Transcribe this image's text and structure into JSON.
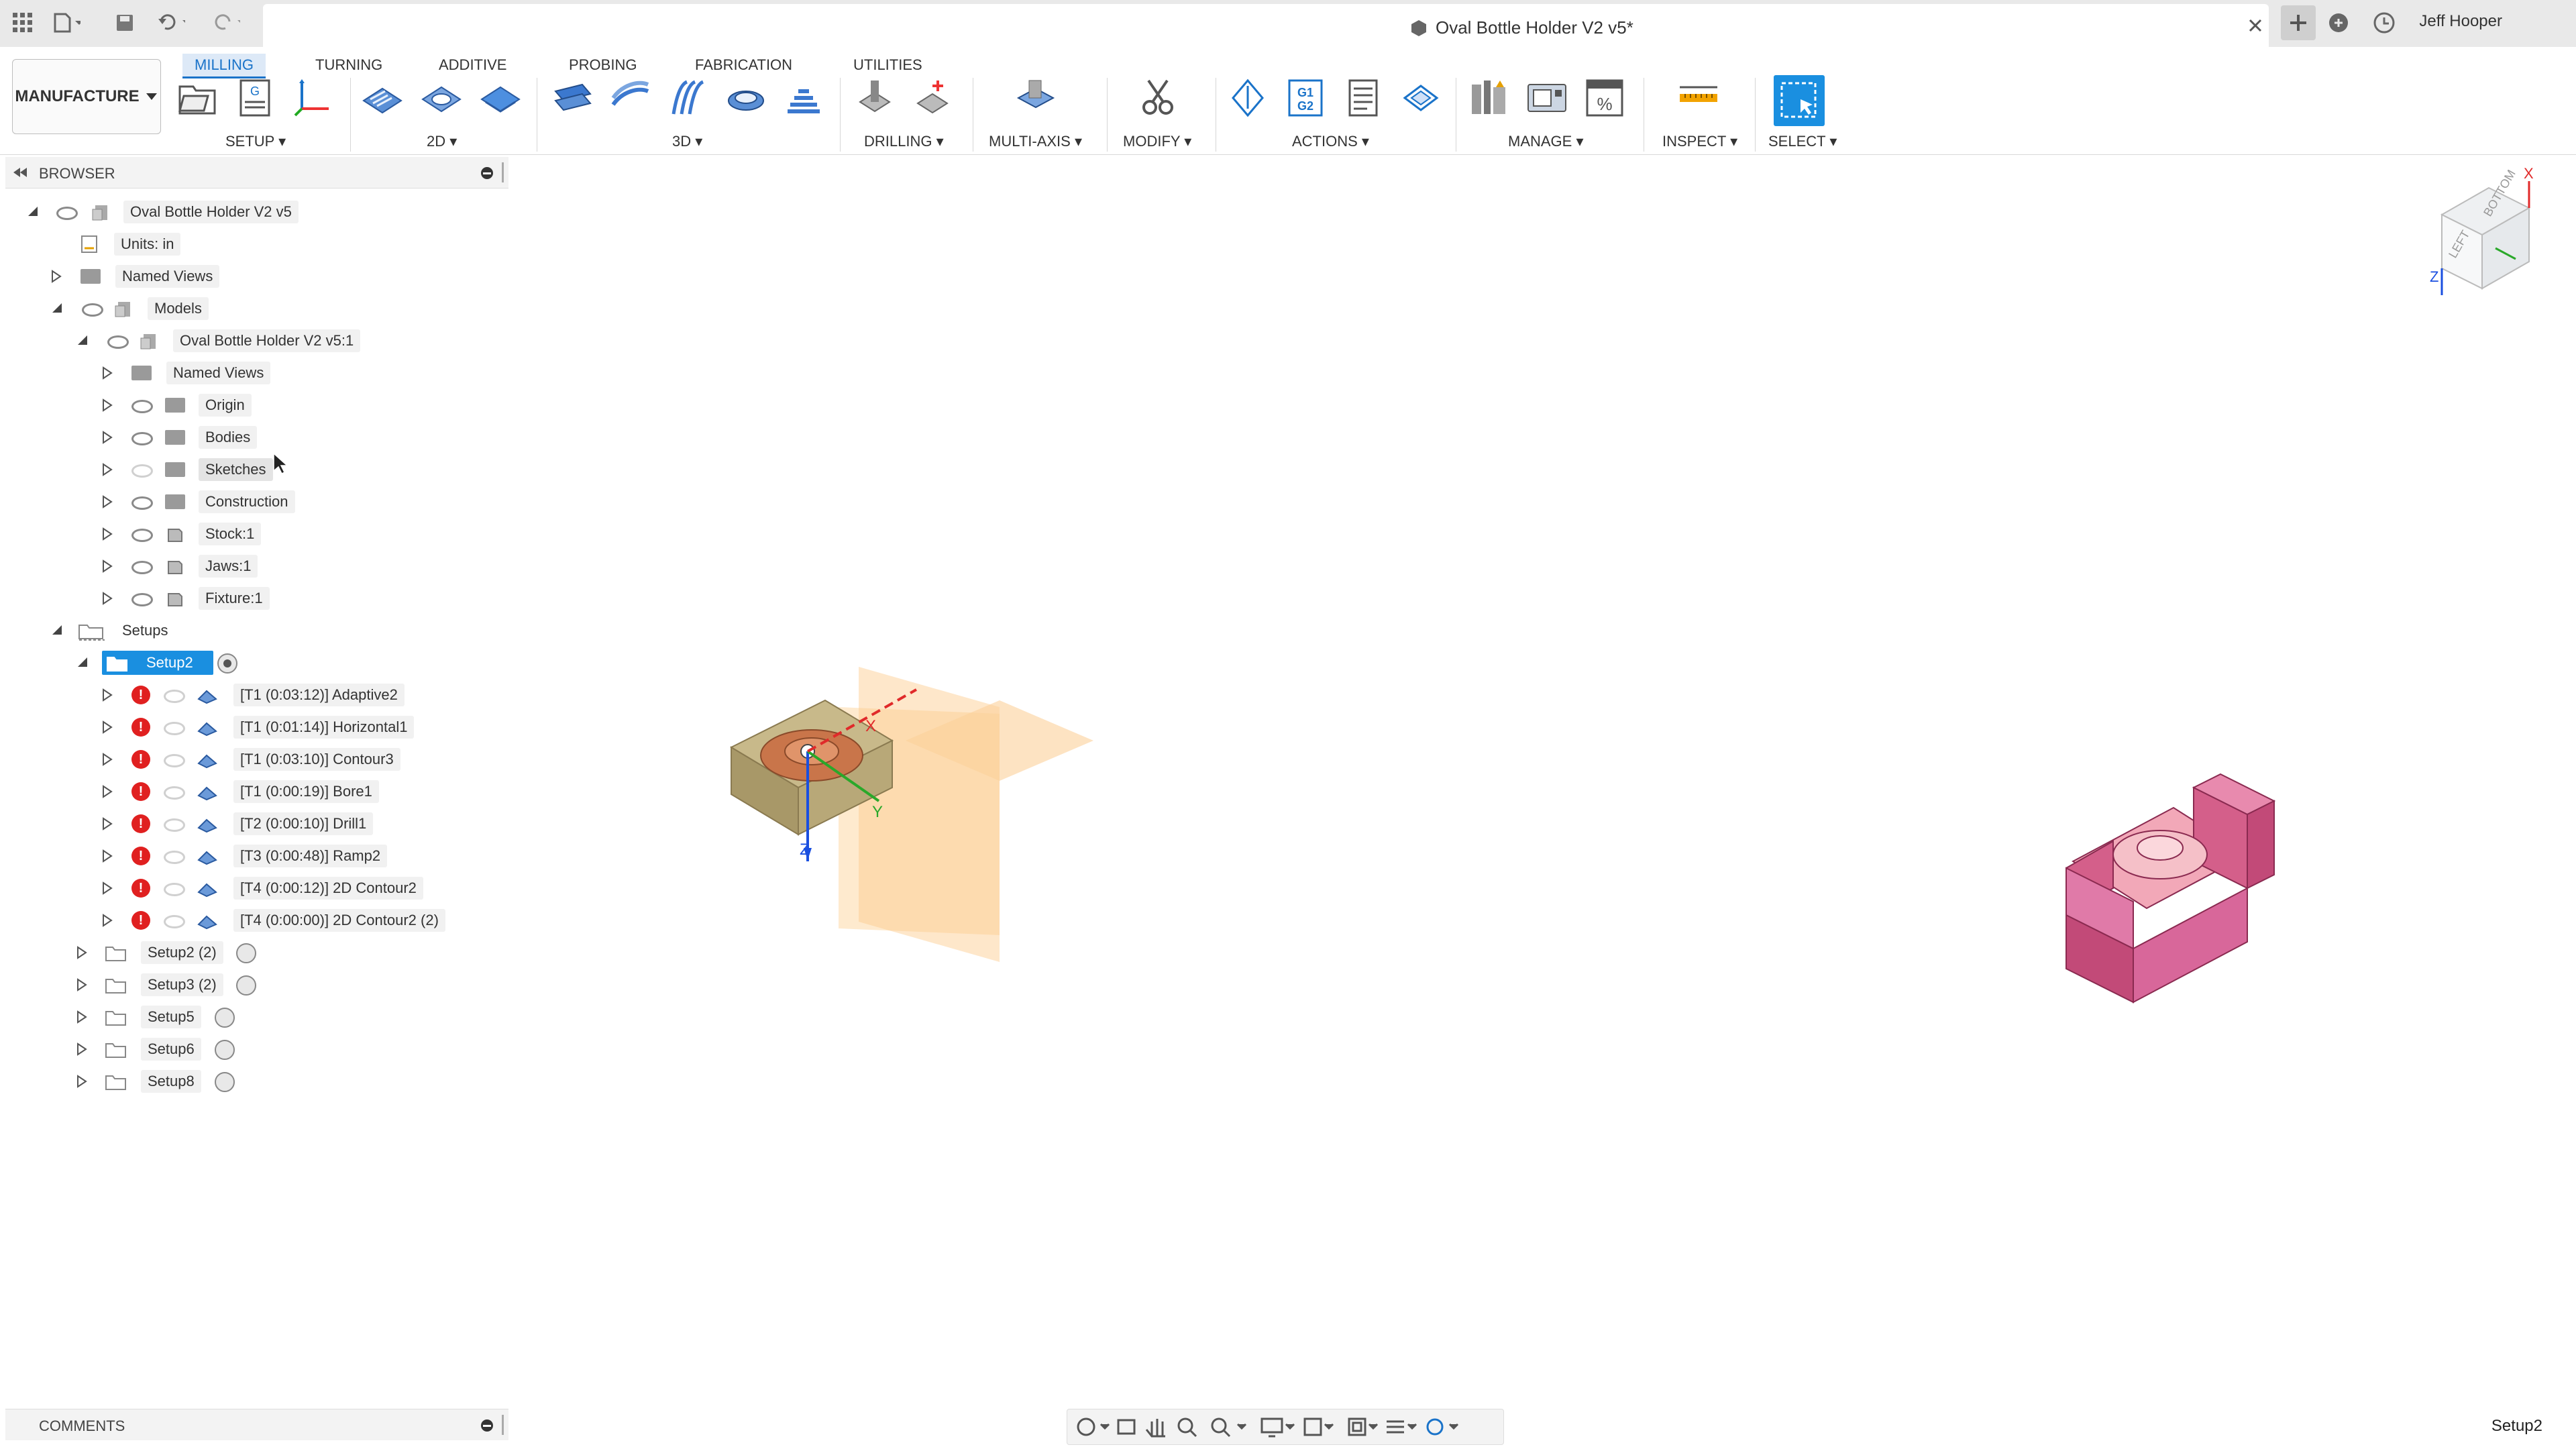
{
  "titlebar": {
    "document_title": "Oval Bottle Holder V2 v5*",
    "user_name": "Jeff Hooper"
  },
  "ribbon": {
    "workspace": "MANUFACTURE",
    "tabs": [
      {
        "label": "MILLING",
        "active": true
      },
      {
        "label": "TURNING",
        "active": false
      },
      {
        "label": "ADDITIVE",
        "active": false
      },
      {
        "label": "PROBING",
        "active": false
      },
      {
        "label": "FABRICATION",
        "active": false
      },
      {
        "label": "UTILITIES",
        "active": false
      }
    ],
    "groups": {
      "setup": "SETUP",
      "two_d": "2D",
      "three_d": "3D",
      "drilling": "DRILLING",
      "multi_axis": "MULTI-AXIS",
      "modify": "MODIFY",
      "actions": "ACTIONS",
      "manage": "MANAGE",
      "inspect": "INSPECT",
      "select": "SELECT"
    },
    "actions_g1g2_label": "G1\nG2",
    "setup_g_label": "G",
    "manage_percent": "%",
    "accent": "#1a73c9"
  },
  "browser": {
    "title": "BROWSER",
    "root": "Oval Bottle Holder V2 v5",
    "units": "Units: in",
    "named_views": "Named Views",
    "models": "Models",
    "model_component": "Oval Bottle Holder V2 v5:1",
    "model_children": [
      "Named Views",
      "Origin",
      "Bodies",
      "Sketches",
      "Construction",
      "Stock:1",
      "Jaws:1",
      "Fixture:1"
    ],
    "setups": "Setups",
    "active_setup": "Setup2",
    "operations": [
      "[T1 (0:03:12)] Adaptive2",
      "[T1 (0:01:14)] Horizontal1",
      "[T1 (0:03:10)] Contour3",
      "[T1 (0:00:19)] Bore1",
      "[T2 (0:00:10)] Drill1",
      "[T3 (0:00:48)] Ramp2",
      "[T4 (0:00:12)] 2D Contour2",
      "[T4 (0:00:00)] 2D Contour2 (2)"
    ],
    "other_setups": [
      "Setup2 (2)",
      "Setup3 (2)",
      "Setup5",
      "Setup6",
      "Setup8"
    ],
    "error_mark": "!"
  },
  "comments": {
    "title": "COMMENTS"
  },
  "statusbar": {
    "active_setup": "Setup2"
  },
  "viewcube": {
    "face_top": "BOTTOM",
    "face_left": "LEFT",
    "axis_x": "X",
    "axis_z": "Z"
  },
  "viewport": {
    "triad_x": "X",
    "triad_y": "Y",
    "triad_z": "Z"
  }
}
